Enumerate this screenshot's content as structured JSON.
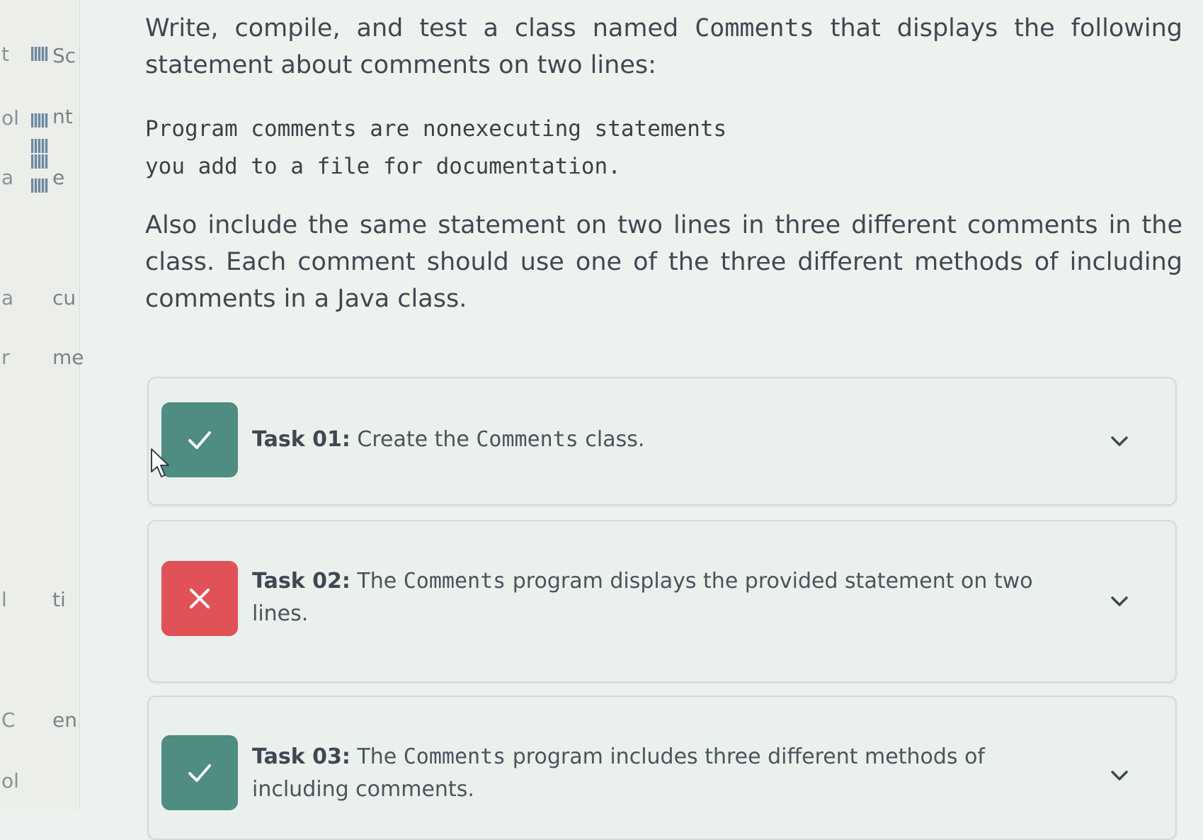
{
  "gutter": {
    "col1": [
      "t",
      "ol",
      "a",
      "a",
      "r",
      "l",
      "C",
      "ol"
    ],
    "col2": [
      "Sc",
      "nt",
      "e",
      "cu",
      "me",
      "ti",
      "en"
    ]
  },
  "instructions": {
    "p1_before": "Write, compile, and test a class named ",
    "p1_code": "Comments",
    "p1_after": " that displays the following statement about comments on two lines:",
    "code_line1": "Program comments are nonexecuting statements",
    "code_line2": "you add to a file for documentation.",
    "p2": "Also include the same statement on two lines in three different comments in the class. Each comment should use one of the three different methods of including comments in a Java class."
  },
  "tasks": [
    {
      "status": "pass",
      "label": "Task 01:",
      "before": " Create the ",
      "code": "Comments",
      "after": " class."
    },
    {
      "status": "fail",
      "label": "Task 02:",
      "before": " The ",
      "code": "Comments",
      "after": " program displays the provided statement on two lines."
    },
    {
      "status": "pass",
      "label": "Task 03:",
      "before": " The ",
      "code": "Comments",
      "after": " program includes three different methods of including comments."
    }
  ],
  "colors": {
    "pass": "#4f8c82",
    "fail": "#e05257"
  }
}
